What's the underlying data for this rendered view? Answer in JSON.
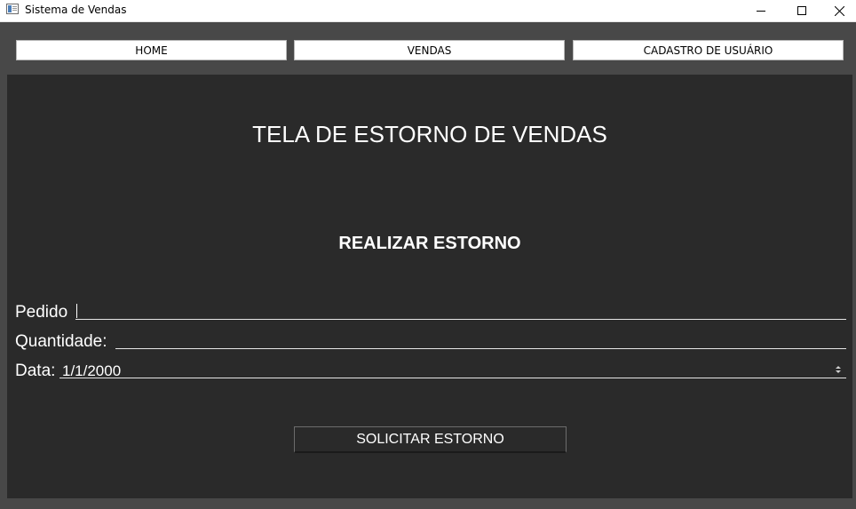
{
  "window": {
    "title": "Sistema de Vendas"
  },
  "titlebar_controls": {
    "minimize_icon": "minimize-icon",
    "maximize_icon": "maximize-icon",
    "close_icon": "close-icon"
  },
  "nav": {
    "items": [
      {
        "label": "HOME"
      },
      {
        "label": "VENDAS"
      },
      {
        "label": "CADASTRO DE USUÁRIO"
      }
    ]
  },
  "page": {
    "title": "TELA DE ESTORNO DE VENDAS",
    "subtitle": "REALIZAR ESTORNO"
  },
  "form": {
    "pedido": {
      "label": "Pedido",
      "value": ""
    },
    "quantidade": {
      "label": "Quantidade:",
      "value": ""
    },
    "data": {
      "label": "Data:",
      "value": "1/1/2000"
    },
    "submit_label": "SOLICITAR ESTORNO"
  },
  "colors": {
    "window_bg": "#484848",
    "panel_bg": "#2a2a2a",
    "nav_button_bg": "#ffffff",
    "text_light": "#ffffff"
  }
}
